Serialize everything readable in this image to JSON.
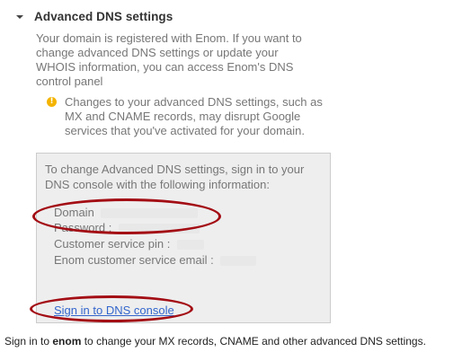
{
  "section": {
    "title": "Advanced DNS settings",
    "intro": "Your domain is registered with Enom. If you want to change advanced DNS settings or update your WHOIS information, you can access Enom's DNS control panel"
  },
  "warning": {
    "icon": "warning-icon",
    "icon_glyph": "!",
    "icon_color": "#f4b400",
    "text": "Changes to your advanced DNS settings, such as MX and CNAME records, may disrupt Google services that you've activated for your domain."
  },
  "dns_box": {
    "intro": "To change Advanced DNS settings, sign in to your DNS console with the following information:",
    "fields": {
      "domain_label": "Domain",
      "password_label": "Password :",
      "pin_label": "Customer service pin :",
      "email_label": "Enom customer service email :"
    },
    "signin_link": "Sign in to DNS console"
  },
  "annotation": {
    "oval_color": "#a30d14"
  },
  "footer": {
    "prefix": "Sign in to ",
    "registrar": "enom",
    "suffix": " to change your MX records, CNAME and other advanced DNS settings."
  }
}
